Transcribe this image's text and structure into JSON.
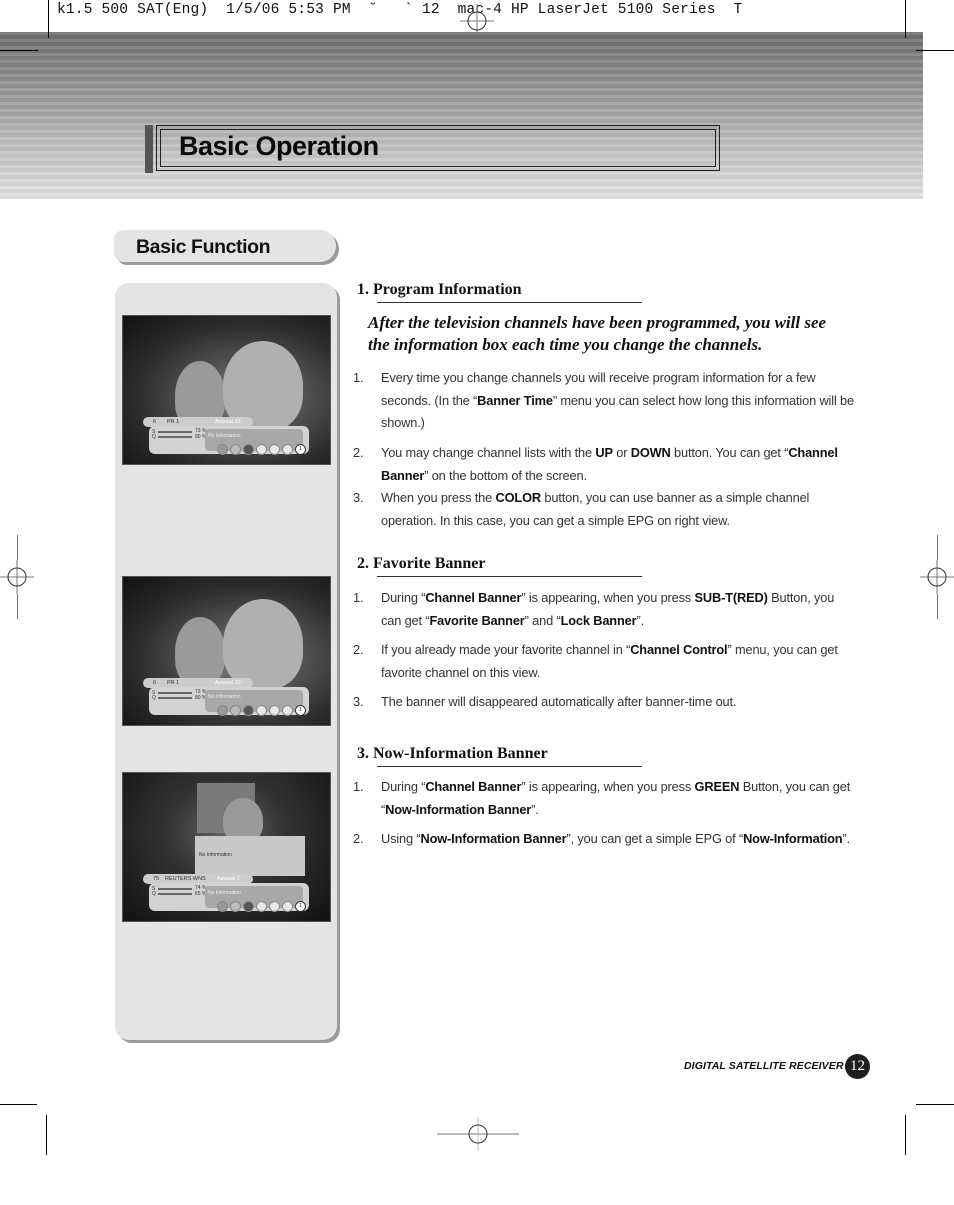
{
  "print_slug": "k1.5 500 SAT(Eng)  1/5/06 5:53 PM  ˘   ` 12  mac-4 HP LaserJet 5100 Series  T",
  "header": {
    "title": "Basic Operation"
  },
  "section_tab": {
    "label": "Basic Function"
  },
  "screenshots": [
    {
      "channel_number": "6",
      "channel_name": "PR 1",
      "satellite": "Asiasat 33",
      "signal_s": "73 %",
      "signal_q": "80 %",
      "info": "No information",
      "badge": "1"
    },
    {
      "channel_number": "6",
      "channel_name": "PR 1",
      "satellite": "Asiasat 33",
      "signal_s": "73 %",
      "signal_q": "80 %",
      "info": "No information",
      "badge": "1"
    },
    {
      "channel_number": "75",
      "channel_name": "REUTERS WNS",
      "satellite": "Asiasat 2",
      "signal_s": "74 %",
      "signal_q": "65 %",
      "info": "No Information",
      "epg_info": "No Information",
      "badge": "1"
    }
  ],
  "sections": [
    {
      "heading": "1. Program Information",
      "lead": "After the television channels have been programmed, you will see the information box each time you change the channels.",
      "items": [
        {
          "num": "1.",
          "parts": [
            {
              "t": "Every time you change channels you will receive program information for a few seconds. (In the “"
            },
            {
              "t": "Banner Time",
              "b": true
            },
            {
              "t": "” menu you can select how long this information will be shown.)"
            }
          ]
        },
        {
          "num": "2.",
          "parts": [
            {
              "t": "You may change channel lists with the "
            },
            {
              "t": "UP",
              "b": true
            },
            {
              "t": " or "
            },
            {
              "t": "DOWN",
              "b": true
            },
            {
              "t": " button. You can get “"
            },
            {
              "t": "Channel Banner",
              "b": true
            },
            {
              "t": "” on the bottom of the screen."
            }
          ]
        },
        {
          "num": "3.",
          "parts": [
            {
              "t": "When you press the "
            },
            {
              "t": "COLOR",
              "b": true
            },
            {
              "t": " button, you can use banner as a simple channel operation. In this case, you can get a simple EPG on right view."
            }
          ]
        }
      ]
    },
    {
      "heading": "2. Favorite Banner",
      "items": [
        {
          "num": "1.",
          "parts": [
            {
              "t": "During “"
            },
            {
              "t": "Channel Banner",
              "b": true
            },
            {
              "t": "” is appearing, when you press "
            },
            {
              "t": "SUB-T(RED)",
              "b": true
            },
            {
              "t": " Button,  you can get “"
            },
            {
              "t": "Favorite Banner",
              "b": true
            },
            {
              "t": "” and “"
            },
            {
              "t": "Lock Banner",
              "b": true
            },
            {
              "t": "”."
            }
          ]
        },
        {
          "num": "2.",
          "parts": [
            {
              "t": "If you already made your favorite channel in “"
            },
            {
              "t": "Channel Control",
              "b": true
            },
            {
              "t": "” menu, you can get favorite channel on this view."
            }
          ]
        },
        {
          "num": "3.",
          "parts": [
            {
              "t": "The banner will disappeared automatically after banner-time out."
            }
          ]
        }
      ]
    },
    {
      "heading": "3. Now-Information Banner",
      "items": [
        {
          "num": "1.",
          "parts": [
            {
              "t": "During “"
            },
            {
              "t": "Channel Banner",
              "b": true
            },
            {
              "t": "” is appearing, when you press "
            },
            {
              "t": "GREEN",
              "b": true
            },
            {
              "t": " Button, you can get “"
            },
            {
              "t": "Now-Information Banner",
              "b": true
            },
            {
              "t": "”."
            }
          ]
        },
        {
          "num": "2.",
          "parts": [
            {
              "t": "Using “"
            },
            {
              "t": "Now-Information Banner",
              "b": true
            },
            {
              "t": "”, you can get a simple EPG of “"
            },
            {
              "t": "Now-Information",
              "b": true
            },
            {
              "t": "”."
            }
          ]
        }
      ]
    }
  ],
  "footer": {
    "product": "DIGITAL SATELLITE RECEIVER",
    "page_number": "12"
  }
}
